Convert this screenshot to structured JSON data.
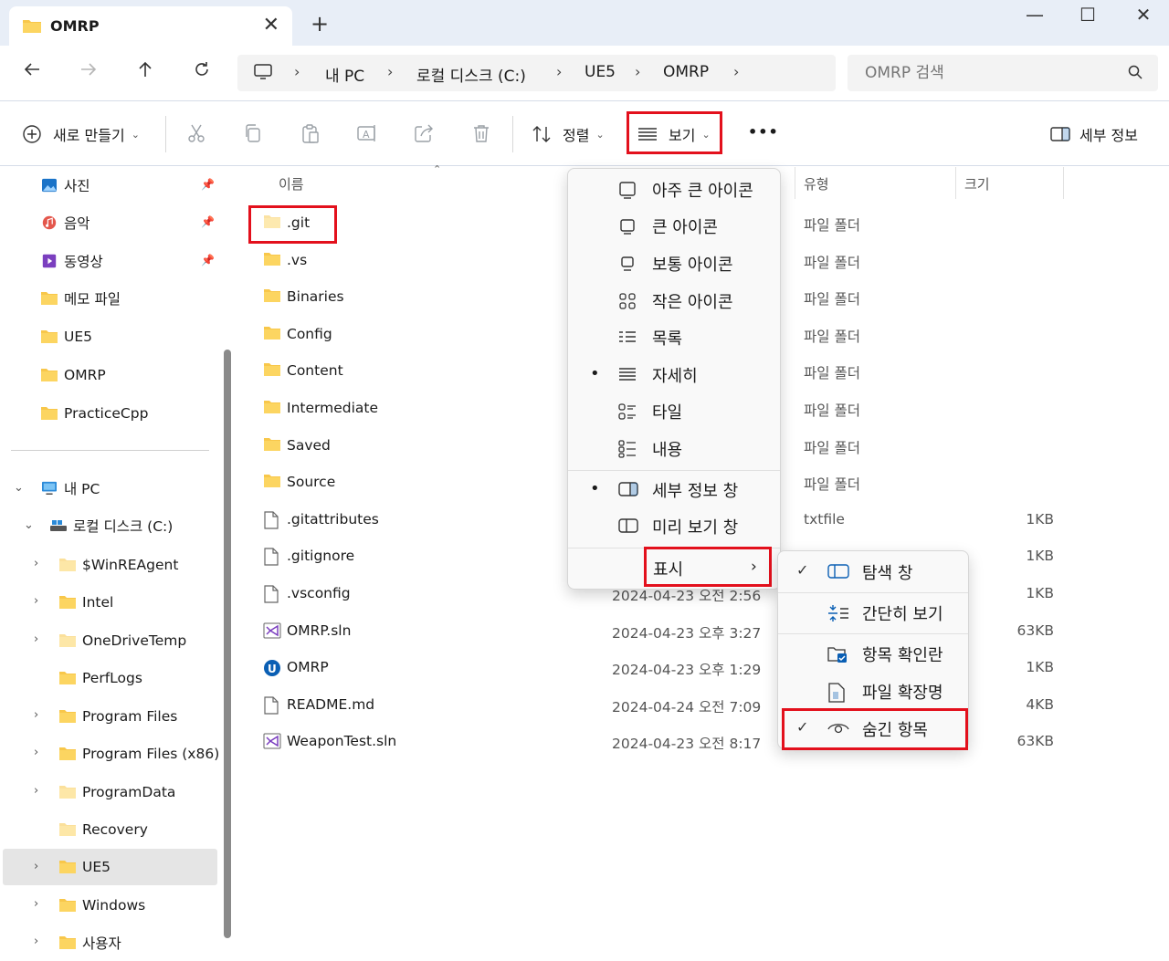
{
  "window": {
    "tab_title": "OMRP",
    "close_tab": "✕",
    "new_tab": "+",
    "minimize": "—",
    "maximize": "☐",
    "close": "✕"
  },
  "address": {
    "breadcrumbs": [
      "내 PC",
      "로컬 디스크 (C:)",
      "UE5",
      "OMRP"
    ],
    "search_placeholder": "OMRP 검색"
  },
  "toolbar": {
    "new_label": "새로 만들기",
    "sort_label": "정렬",
    "view_label": "보기",
    "more_label": "•••",
    "details_label": "세부 정보"
  },
  "sidebar": {
    "quick": [
      {
        "label": "사진",
        "icon": "photos-icon",
        "pinned": true
      },
      {
        "label": "음악",
        "icon": "music-icon",
        "pinned": true
      },
      {
        "label": "동영상",
        "icon": "video-icon",
        "pinned": true
      },
      {
        "label": "메모 파일",
        "icon": "folder-icon",
        "pinned": false
      },
      {
        "label": "UE5",
        "icon": "folder-icon",
        "pinned": false
      },
      {
        "label": "OMRP",
        "icon": "folder-icon",
        "pinned": false
      },
      {
        "label": "PracticeCpp",
        "icon": "folder-icon",
        "pinned": false
      }
    ],
    "this_pc": "내 PC",
    "drive": "로컬 디스크 (C:)",
    "folders": [
      "$WinREAgent",
      "Intel",
      "OneDriveTemp",
      "PerfLogs",
      "Program Files",
      "Program Files (x86)",
      "ProgramData",
      "Recovery",
      "UE5",
      "Windows",
      "사용자"
    ]
  },
  "columns": {
    "name": "이름",
    "type": "유형",
    "size": "크기"
  },
  "files": [
    {
      "name": ".git",
      "date": "",
      "type": "파일 폴더",
      "size": "",
      "kind": "folder-faded"
    },
    {
      "name": ".vs",
      "date": "",
      "type": "파일 폴더",
      "size": "",
      "kind": "folder"
    },
    {
      "name": "Binaries",
      "date": "",
      "type": "파일 폴더",
      "size": "",
      "kind": "folder"
    },
    {
      "name": "Config",
      "date": "",
      "type": "파일 폴더",
      "size": "",
      "kind": "folder"
    },
    {
      "name": "Content",
      "date": "",
      "type": "파일 폴더",
      "size": "",
      "kind": "folder"
    },
    {
      "name": "Intermediate",
      "date": "",
      "type": "파일 폴더",
      "size": "",
      "kind": "folder"
    },
    {
      "name": "Saved",
      "date": "",
      "type": "파일 폴더",
      "size": "",
      "kind": "folder"
    },
    {
      "name": "Source",
      "date": "",
      "type": "파일 폴더",
      "size": "",
      "kind": "folder"
    },
    {
      "name": ".gitattributes",
      "date": "",
      "type": "txtfile",
      "size": "1KB",
      "kind": "file"
    },
    {
      "name": ".gitignore",
      "date": "",
      "type": "",
      "size": "1KB",
      "kind": "file"
    },
    {
      "name": ".vsconfig",
      "date": "2024-04-23 오전 2:56",
      "type": "",
      "size": "1KB",
      "kind": "file"
    },
    {
      "name": "OMRP.sln",
      "date": "2024-04-23 오후 3:27",
      "type": "",
      "size": "63KB",
      "kind": "sln"
    },
    {
      "name": "OMRP",
      "date": "2024-04-23 오후 1:29",
      "type": "",
      "size": "1KB",
      "kind": "uproject"
    },
    {
      "name": "README.md",
      "date": "2024-04-24 오전 7:09",
      "type": "",
      "size": "4KB",
      "kind": "file"
    },
    {
      "name": "WeaponTest.sln",
      "date": "2024-04-23 오전 8:17",
      "type": "",
      "size": "63KB",
      "kind": "sln"
    }
  ],
  "view_menu": {
    "items": [
      {
        "label": "아주 큰 아이콘",
        "icon": "extra-large-icons-icon",
        "selected": false
      },
      {
        "label": "큰 아이콘",
        "icon": "large-icons-icon",
        "selected": false
      },
      {
        "label": "보통 아이콘",
        "icon": "medium-icons-icon",
        "selected": false
      },
      {
        "label": "작은 아이콘",
        "icon": "small-icons-icon",
        "selected": false
      },
      {
        "label": "목록",
        "icon": "list-icon",
        "selected": false
      },
      {
        "label": "자세히",
        "icon": "details-icon",
        "selected": true
      },
      {
        "label": "타일",
        "icon": "tiles-icon",
        "selected": false
      },
      {
        "label": "내용",
        "icon": "content-icon",
        "selected": false
      }
    ],
    "panes": [
      {
        "label": "세부 정보 창",
        "icon": "details-pane-icon",
        "selected": true
      },
      {
        "label": "미리 보기 창",
        "icon": "preview-pane-icon",
        "selected": false
      }
    ],
    "show_label": "표시"
  },
  "show_menu": {
    "items": [
      {
        "label": "탐색 창",
        "icon": "navigation-pane-icon",
        "checked": true
      },
      {
        "label": "간단히 보기",
        "icon": "compact-view-icon",
        "checked": false
      },
      {
        "label": "항목 확인란",
        "icon": "item-checkbox-icon",
        "checked": false
      },
      {
        "label": "파일 확장명",
        "icon": "file-extension-icon",
        "checked": false
      },
      {
        "label": "숨긴 항목",
        "icon": "hidden-items-icon",
        "checked": true
      }
    ]
  },
  "colors": {
    "highlight_red": "#e3101c",
    "folder_yellow": "#f8c74a",
    "accent_blue": "#0a5fb4"
  }
}
